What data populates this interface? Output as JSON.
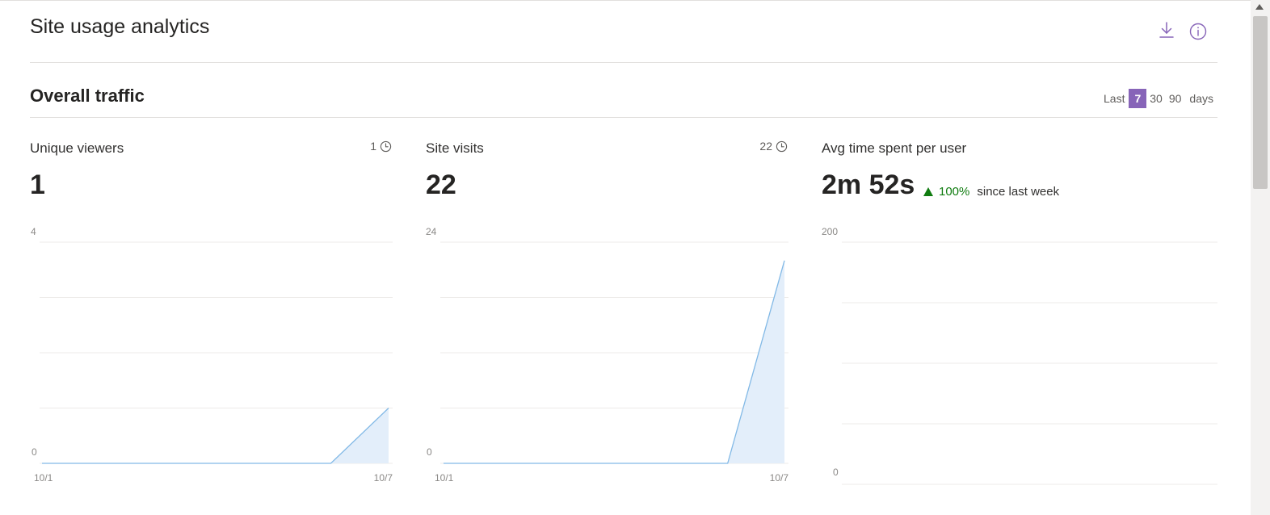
{
  "header": {
    "title": "Site usage analytics",
    "download_icon": "download-icon",
    "info_icon": "info-icon"
  },
  "section": {
    "title": "Overall traffic",
    "range": {
      "label": "Last",
      "options": [
        "7",
        "30",
        "90"
      ],
      "selected": "7",
      "suffix": "days"
    }
  },
  "colors": {
    "accent": "#8764b8",
    "area_line": "#82b9e6",
    "area_fill": "#e3eefa",
    "trend_up": "#107c10"
  },
  "cards": [
    {
      "label": "Unique viewers",
      "badge": "1",
      "badge_icon": "clock-icon",
      "value": "1"
    },
    {
      "label": "Site visits",
      "badge": "22",
      "badge_icon": "clock-icon",
      "value": "22"
    },
    {
      "label": "Avg time spent per user",
      "value": "2m 52s",
      "trend": {
        "direction": "up",
        "percent": "100%",
        "text": "since last week"
      }
    }
  ],
  "chart_data": [
    {
      "type": "area",
      "ylim": [
        0,
        4
      ],
      "y_tick_labels": [
        "4",
        "0"
      ],
      "x_tick_labels": [
        "10/1",
        "10/7"
      ],
      "x": [
        "10/1",
        "10/2",
        "10/3",
        "10/4",
        "10/5",
        "10/6",
        "10/7"
      ],
      "values": [
        0,
        0,
        0,
        0,
        0,
        0,
        1
      ]
    },
    {
      "type": "area",
      "ylim": [
        0,
        24
      ],
      "y_tick_labels": [
        "24",
        "0"
      ],
      "x_tick_labels": [
        "10/1",
        "10/7"
      ],
      "x": [
        "10/1",
        "10/2",
        "10/3",
        "10/4",
        "10/5",
        "10/6",
        "10/7"
      ],
      "values": [
        0,
        0,
        0,
        0,
        0,
        0,
        22
      ]
    },
    {
      "type": "area",
      "ylim": [
        0,
        200
      ],
      "y_tick_labels": [
        "200",
        "0"
      ],
      "x_tick_labels": [],
      "x": [],
      "values": []
    }
  ]
}
